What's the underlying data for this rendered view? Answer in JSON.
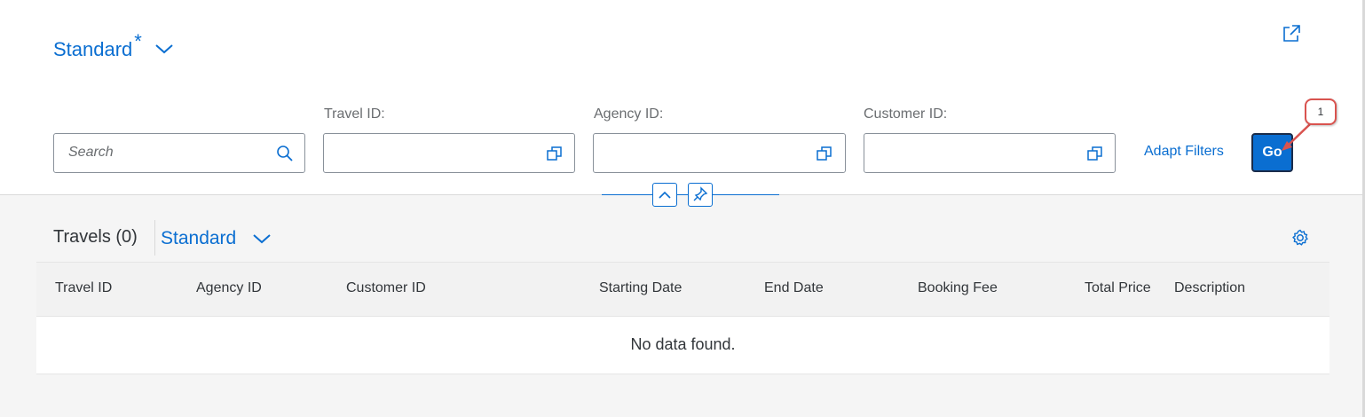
{
  "variant": {
    "title": "Standard",
    "dirty_marker": "*"
  },
  "filters": {
    "search_placeholder": "Search",
    "travel_id_label": "Travel ID:",
    "agency_id_label": "Agency ID:",
    "customer_id_label": "Customer ID:",
    "adapt_label": "Adapt Filters",
    "go_label": "Go"
  },
  "callout": {
    "number": "1"
  },
  "table": {
    "title": "Travels (0)",
    "variant": "Standard",
    "columns": [
      "Travel ID",
      "Agency ID",
      "Customer ID",
      "Starting Date",
      "End Date",
      "Booking Fee",
      "Total Price",
      "Description"
    ],
    "no_data": "No data found."
  },
  "icons": {
    "variant_chevron": "chevron-down-icon",
    "share": "share-icon",
    "search": "search-icon",
    "value_help": "value-help-icon",
    "collapse": "chevron-up-icon",
    "pin": "pin-icon",
    "settings": "gear-icon"
  },
  "colors": {
    "accent": "#0a6ed1",
    "callout": "#d9534f",
    "go_border": "#1a2c4a"
  }
}
